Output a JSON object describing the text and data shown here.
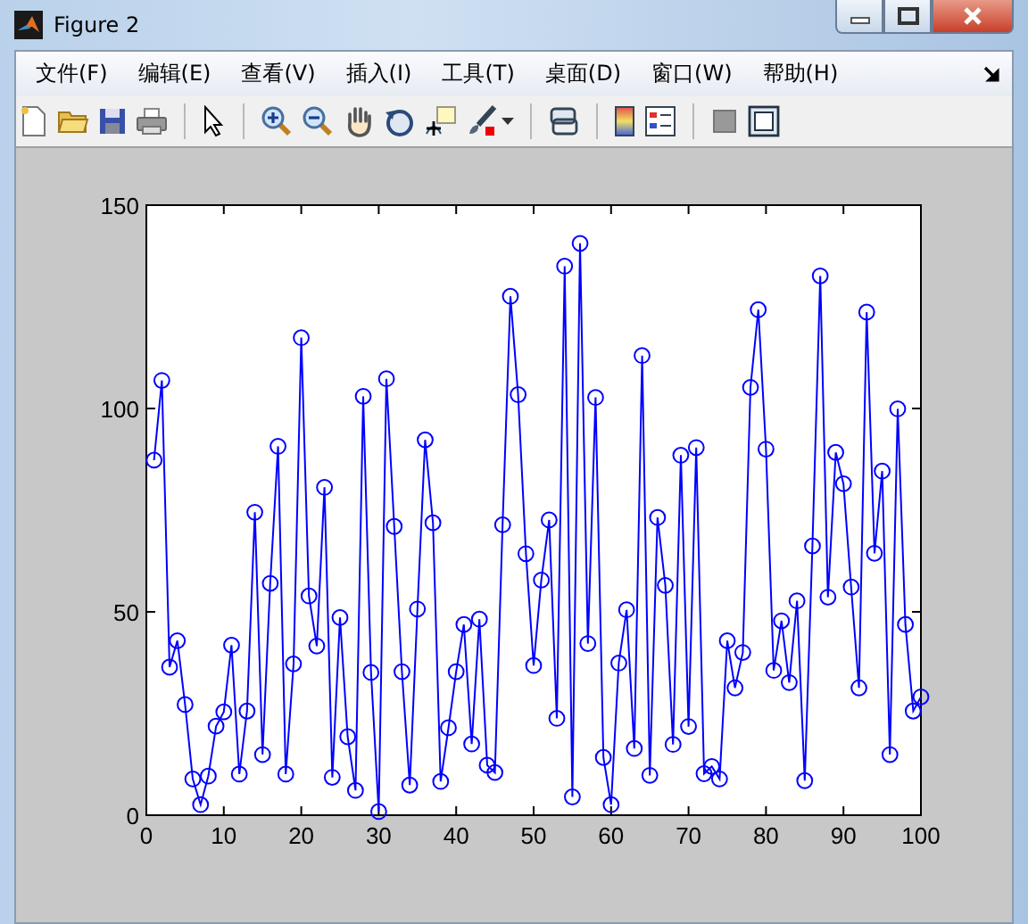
{
  "window": {
    "title": "Figure 2"
  },
  "menu": [
    {
      "label": "文件(F)"
    },
    {
      "label": "编辑(E)"
    },
    {
      "label": "查看(V)"
    },
    {
      "label": "插入(I)"
    },
    {
      "label": "工具(T)"
    },
    {
      "label": "桌面(D)"
    },
    {
      "label": "窗口(W)"
    },
    {
      "label": "帮助(H)"
    }
  ],
  "figure": {
    "chart_data": {
      "type": "line",
      "x": [
        1,
        2,
        3,
        4,
        5,
        6,
        7,
        8,
        9,
        10,
        11,
        12,
        13,
        14,
        15,
        16,
        17,
        18,
        19,
        20,
        21,
        22,
        23,
        24,
        25,
        26,
        27,
        28,
        29,
        30,
        31,
        32,
        33,
        34,
        35,
        36,
        37,
        38,
        39,
        40,
        41,
        42,
        43,
        44,
        45,
        46,
        47,
        48,
        49,
        50,
        51,
        52,
        53,
        54,
        55,
        56,
        57,
        58,
        59,
        60,
        61,
        62,
        63,
        64,
        65,
        66,
        67,
        68,
        69,
        70,
        71,
        72,
        73,
        74,
        75,
        76,
        77,
        78,
        79,
        80,
        81,
        82,
        83,
        84,
        85,
        86,
        87,
        88,
        89,
        90,
        91,
        92,
        93,
        94,
        95,
        96,
        97,
        98,
        99,
        100
      ],
      "series": [
        {
          "color": "#0000ff",
          "marker": "o",
          "values": [
            87.3,
            106.9,
            36.4,
            42.9,
            27.2,
            8.9,
            2.6,
            9.6,
            21.9,
            25.4,
            41.8,
            10.1,
            25.6,
            74.5,
            14.9,
            57,
            90.7,
            10.1,
            37.2,
            117.4,
            53.9,
            41.6,
            80.6,
            9.3,
            48.6,
            19.3,
            6.1,
            103,
            35.1,
            0.9,
            107.3,
            71,
            35.3,
            7.4,
            50.7,
            92.3,
            71.9,
            8.3,
            21.5,
            35.3,
            46.9,
            17.5,
            48.2,
            12.3,
            10.5,
            71.4,
            127.6,
            103.4,
            64.3,
            36.8,
            57.8,
            72.6,
            23.8,
            135,
            4.5,
            140.6,
            42.2,
            102.7,
            14.2,
            2.6,
            37.4,
            50.5,
            16.4,
            113,
            9.8,
            73.2,
            56.5,
            17.4,
            88.5,
            21.8,
            90.4,
            10.2,
            12,
            8.9,
            42.9,
            31.3,
            40,
            105.2,
            124.3,
            90,
            35.6,
            47.8,
            32.6,
            52.7,
            8.5,
            66.2,
            132.6,
            53.6,
            89.2,
            81.5,
            56.1,
            31.3,
            123.7,
            64.4,
            84.6,
            14.9,
            99.9,
            46.9,
            25.6,
            29.1
          ]
        }
      ],
      "xlim": [
        0,
        100
      ],
      "ylim": [
        0,
        150
      ],
      "xticks": [
        0,
        10,
        20,
        30,
        40,
        50,
        60,
        70,
        80,
        90,
        100
      ],
      "yticks": [
        0,
        50,
        100,
        150
      ]
    }
  }
}
